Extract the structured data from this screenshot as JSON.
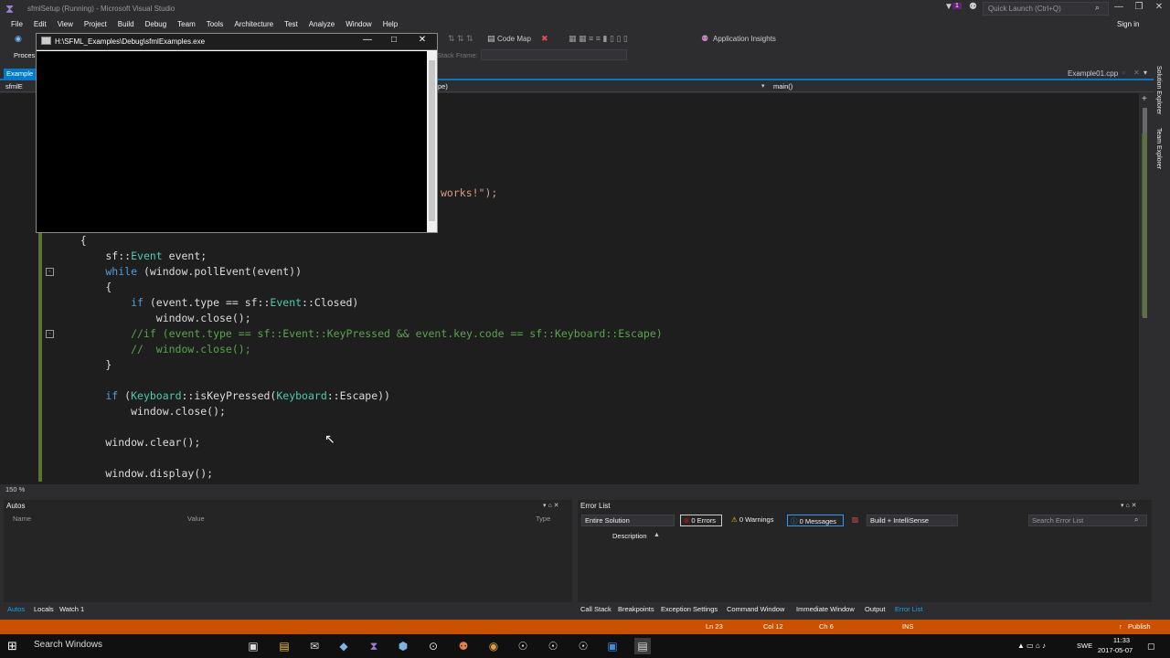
{
  "titlebar": {
    "title": "sfmlSetup (Running) - Microsoft Visual Studio",
    "quick_launch_placeholder": "Quick Launch (Ctrl+Q)",
    "notification_count": "1"
  },
  "menu": {
    "items": [
      "File",
      "Edit",
      "View",
      "Project",
      "Build",
      "Debug",
      "Team",
      "Tools",
      "Architecture",
      "Test",
      "Analyze",
      "Window",
      "Help"
    ],
    "sign_in": "Sign in"
  },
  "toolbar": {
    "code_map": "Code Map",
    "application_insights": "Application Insights",
    "process_label": "Proces",
    "stack_frame_label": "Stack Frame:"
  },
  "tabs": {
    "left_tab": "Example",
    "right_tab": "Example01.cpp"
  },
  "navbar": {
    "left": "sfmlE",
    "middle": "pe)",
    "right": "main()"
  },
  "console": {
    "path": "H:\\SFML_Examples\\Debug\\sfmlExamples.exe"
  },
  "code": {
    "works_fragment": "works!\");",
    "lines": [
      "    {",
      "        sf::Event event;",
      "        while (window.pollEvent(event))",
      "        {",
      "            if (event.type == sf::Event::Closed)",
      "                window.close();",
      "            //if (event.type == sf::Event::KeyPressed && event.key.code == sf::Keyboard::Escape)",
      "            //  window.close();",
      "        }",
      "",
      "        if (Keyboard::isKeyPressed(Keyboard::Escape))",
      "            window.close();",
      "",
      "        window.clear();",
      "",
      "        window.display();"
    ]
  },
  "zoom": "150 %",
  "autos": {
    "title": "Autos",
    "col_name": "Name",
    "col_value": "Value",
    "col_type": "Type",
    "tabs": [
      "Autos",
      "Locals",
      "Watch 1"
    ]
  },
  "error_list": {
    "title": "Error List",
    "scope": "Entire Solution",
    "errors": "0 Errors",
    "warnings": "0 Warnings",
    "messages": "0 Messages",
    "build_filter": "Build + IntelliSense",
    "search_placeholder": "Search Error List",
    "col_description": "Description",
    "tabs": [
      "Call Stack",
      "Breakpoints",
      "Exception Settings",
      "Command Window",
      "Immediate Window",
      "Output",
      "Error List"
    ]
  },
  "statusbar": {
    "ln": "Ln 23",
    "col": "Col 12",
    "ch": "Ch 6",
    "mode": "INS",
    "publish": "Publish"
  },
  "taskbar": {
    "search": "Search Windows",
    "lang": "SWE",
    "time": "11:33",
    "date": "2017-05-07"
  },
  "side_tabs": [
    "Solution Explorer",
    "Team Explorer"
  ],
  "colors": {
    "accent": "#007acc",
    "statusbar": "#ca5100",
    "editor_bg": "#1e1e1e"
  }
}
